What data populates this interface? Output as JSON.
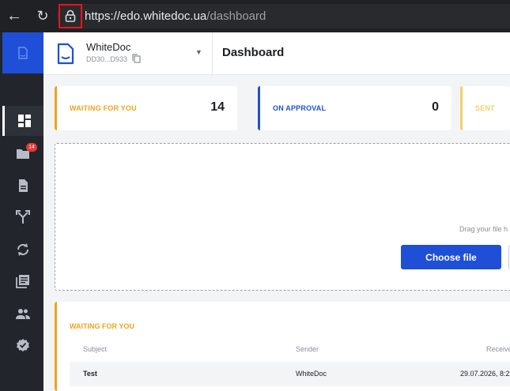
{
  "browser": {
    "url_domain": "https://edo.whitedoc.ua",
    "url_path": "/dashboard"
  },
  "icons": {
    "back": "arrow-left-icon",
    "reload": "reload-icon",
    "lock": "lock-icon",
    "logo": "document-icon",
    "copy": "copy-icon"
  },
  "colors": {
    "accent": "#1e4fd6",
    "waiting": "#f0a31c",
    "sent": "#f4cf6a",
    "highlight": "#e8151b",
    "rail": "#22262c"
  },
  "sidebar": {
    "items": [
      {
        "icon": "dashboard-icon",
        "active": true
      },
      {
        "icon": "folder-icon",
        "badge": "14"
      },
      {
        "icon": "document-icon"
      },
      {
        "icon": "route-icon"
      },
      {
        "icon": "sync-icon"
      },
      {
        "icon": "library-icon"
      },
      {
        "icon": "users-icon"
      },
      {
        "icon": "verified-icon"
      }
    ]
  },
  "header": {
    "org_name": "WhiteDoc",
    "org_id": "DD30...D933",
    "title": "Dashboard"
  },
  "stats": {
    "waiting_label": "WAITING FOR YOU",
    "waiting_count": "14",
    "approval_label": "ON APPROVAL",
    "approval_count": "0",
    "sent_label": "SENT"
  },
  "dropzone": {
    "hint": "Drag your file h",
    "choose_label": "Choose file"
  },
  "waiting_panel": {
    "title": "WAITING FOR YOU",
    "columns": [
      "Subject",
      "Sender",
      "Receive"
    ],
    "rows": [
      {
        "subject": "Test",
        "sender": "WhiteDoc",
        "received": "29.07.2026, 8:2"
      }
    ]
  }
}
